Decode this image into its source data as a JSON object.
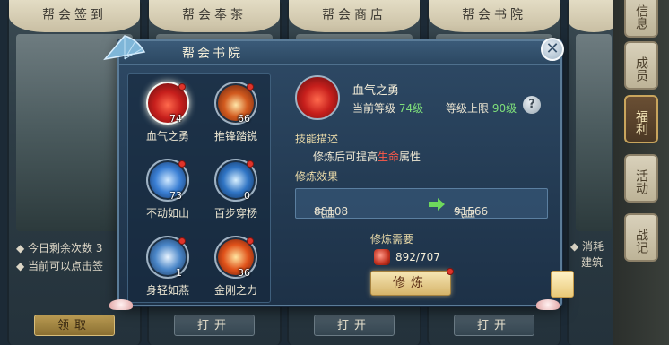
{
  "background": {
    "cards": [
      {
        "title": "帮会签到",
        "button": "领取",
        "gold": true
      },
      {
        "title": "帮会奉茶",
        "button": "打开",
        "gold": false
      },
      {
        "title": "帮会商店",
        "button": "打开",
        "gold": false
      },
      {
        "title": "帮会书院",
        "button": "打开",
        "gold": false
      }
    ],
    "notes": {
      "line1": "◆ 今日剩余次数 3",
      "line2": "◆ 当前可以点击签",
      "right1": "◆ 消耗",
      "right2": "建筑"
    },
    "right_rail": [
      {
        "label": "信息",
        "active": false
      },
      {
        "label": "成员",
        "active": false
      },
      {
        "label": "福利",
        "active": true
      },
      {
        "label": "活动",
        "active": false
      },
      {
        "label": "战记",
        "active": false
      }
    ]
  },
  "dialog": {
    "title": "帮会书院",
    "close_label": "✕",
    "skills": [
      {
        "name": "血气之勇",
        "level": "74",
        "icon": "heart-skill-icon",
        "selected": true,
        "dot": true
      },
      {
        "name": "推锋踏锐",
        "level": "66",
        "icon": "sword-burst-skill-icon",
        "selected": false,
        "dot": true
      },
      {
        "name": "不动如山",
        "level": "73",
        "icon": "shield-skill-icon",
        "selected": false,
        "dot": true
      },
      {
        "name": "百步穿杨",
        "level": "0",
        "icon": "spear-skill-icon",
        "selected": false,
        "dot": true
      },
      {
        "name": "身轻如燕",
        "level": "1",
        "icon": "wind-skill-icon",
        "selected": false,
        "dot": true
      },
      {
        "name": "金刚之力",
        "level": "36",
        "icon": "burst-skill-icon",
        "selected": false,
        "dot": true
      }
    ],
    "detail": {
      "name": "血气之勇",
      "current_level_label": "当前等级",
      "current_level_value": "74级",
      "max_level_label": "等级上限",
      "max_level_value": "90级",
      "help_label": "?",
      "desc_title": "技能描述",
      "desc_prefix": "修炼后可提高",
      "desc_highlight": "生命",
      "desc_suffix": "属性",
      "effect_title": "修炼效果",
      "effect_from_label": "气血",
      "effect_from_value": "88108",
      "effect_to_label": "气血",
      "effect_to_value": "91566",
      "cost_title": "修炼需要",
      "cost_value": "892/707",
      "action_label": "修炼"
    }
  },
  "colors": {
    "highlight_green": "#7fe07a",
    "highlight_red": "#ff5a48",
    "dialog_bg": "#2e4a66"
  }
}
